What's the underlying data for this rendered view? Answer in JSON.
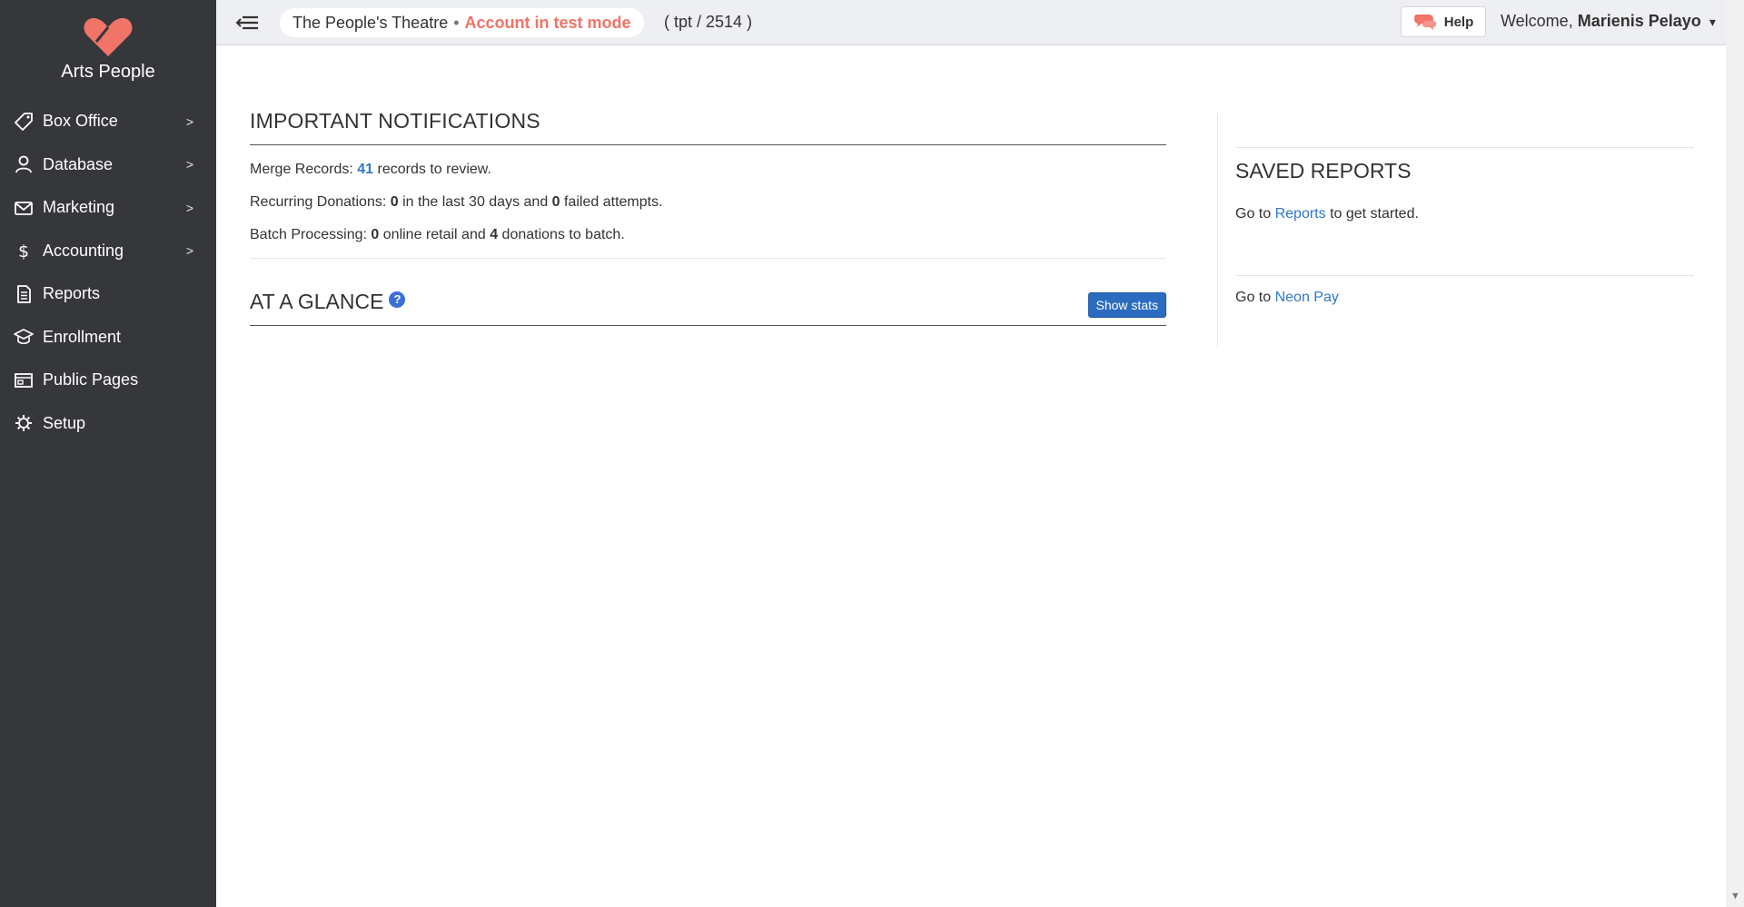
{
  "brand": {
    "name": "Arts People",
    "logo_color": "#f07468"
  },
  "sidebar": {
    "items": [
      {
        "label": "Box Office",
        "icon": "ticket-icon",
        "has_submenu": true
      },
      {
        "label": "Database",
        "icon": "user-icon",
        "has_submenu": true
      },
      {
        "label": "Marketing",
        "icon": "envelope-icon",
        "has_submenu": true
      },
      {
        "label": "Accounting",
        "icon": "dollar-icon",
        "has_submenu": true
      },
      {
        "label": "Reports",
        "icon": "document-icon",
        "has_submenu": false
      },
      {
        "label": "Enrollment",
        "icon": "graduation-cap-icon",
        "has_submenu": false
      },
      {
        "label": "Public Pages",
        "icon": "browser-window-icon",
        "has_submenu": false
      },
      {
        "label": "Setup",
        "icon": "gear-icon",
        "has_submenu": false
      }
    ],
    "chevron": ">"
  },
  "topbar": {
    "org_name": "The People's Theatre",
    "separator": "•",
    "mode_label": "Account in test mode",
    "org_code": "( tpt / 2514 )",
    "help_label": "Help",
    "welcome_prefix": "Welcome,",
    "user_name": "Marienis Pelayo",
    "caret": "▾"
  },
  "notifications": {
    "title": "IMPORTANT NOTIFICATIONS",
    "merge": {
      "prefix": "Merge Records:",
      "count": "41",
      "suffix": "records to review."
    },
    "recurring": {
      "prefix": "Recurring Donations:",
      "count1": "0",
      "middle": "in the last 30 days and",
      "count2": "0",
      "suffix": "failed attempts."
    },
    "batch": {
      "prefix": "Batch Processing:",
      "count1": "0",
      "middle": "online retail and",
      "count2": "4",
      "suffix": "donations to batch."
    }
  },
  "glance": {
    "title": "AT A GLANCE",
    "help_glyph": "?",
    "show_stats_label": "Show stats"
  },
  "saved_reports": {
    "title": "SAVED REPORTS",
    "prefix": "Go to",
    "link": "Reports",
    "suffix": "to get started."
  },
  "neon_pay": {
    "prefix": "Go to",
    "link": "Neon Pay"
  },
  "colors": {
    "sidebar_bg": "#35373b",
    "accent": "#f07468",
    "link": "#2f77c5",
    "button": "#2b6cc0"
  }
}
